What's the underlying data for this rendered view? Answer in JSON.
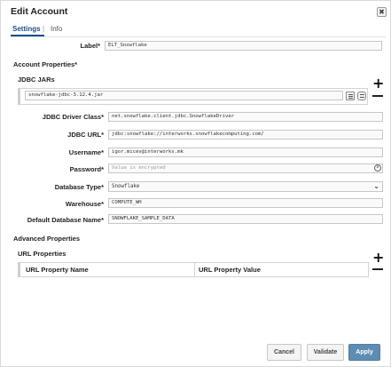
{
  "dialog": {
    "title": "Edit Account",
    "close_glyph": "✖"
  },
  "tabs": {
    "settings": "Settings",
    "separator": "|",
    "info": "Info"
  },
  "label_row": {
    "label": "Label*",
    "value": "ELT_Snowflake"
  },
  "account_properties": {
    "heading": "Account Properties*"
  },
  "jdbc_jars": {
    "heading": "JDBC JARs",
    "items": [
      {
        "value": "snowflake-jdbc-3.12.4.jar"
      }
    ],
    "add_glyph": "+",
    "icons": [
      "file-browse-icon",
      "database-icon"
    ]
  },
  "fields": {
    "driver_class": {
      "label": "JDBC Driver Class*",
      "value": "net.snowflake.client.jdbc.SnowflakeDriver"
    },
    "jdbc_url": {
      "label": "JDBC URL*",
      "value": "jdbc:snowflake://interworks.snowflakecomputing.com/"
    },
    "username": {
      "label": "Username*",
      "value": "igor.micev@interworks.mk"
    },
    "password": {
      "label": "Password*",
      "placeholder": "Value is encrypted",
      "clear_glyph": "×"
    },
    "database_type": {
      "label": "Database Type*",
      "value": "Snowflake",
      "chevron": "⌄"
    },
    "warehouse": {
      "label": "Warehouse*",
      "value": "COMPUTE_WH"
    },
    "default_db": {
      "label": "Default Database Name*",
      "value": "SNOWFLAKE_SAMPLE_DATA"
    }
  },
  "advanced": {
    "heading": "Advanced Properties",
    "url_properties": {
      "heading": "URL Properties",
      "add_glyph": "+",
      "columns": [
        "URL Property Name",
        "URL Property Value"
      ]
    }
  },
  "buttons": {
    "cancel": "Cancel",
    "validate": "Validate",
    "apply": "Apply"
  },
  "colors": {
    "accent": "#1f4f82",
    "apply": "#5d8db3"
  }
}
